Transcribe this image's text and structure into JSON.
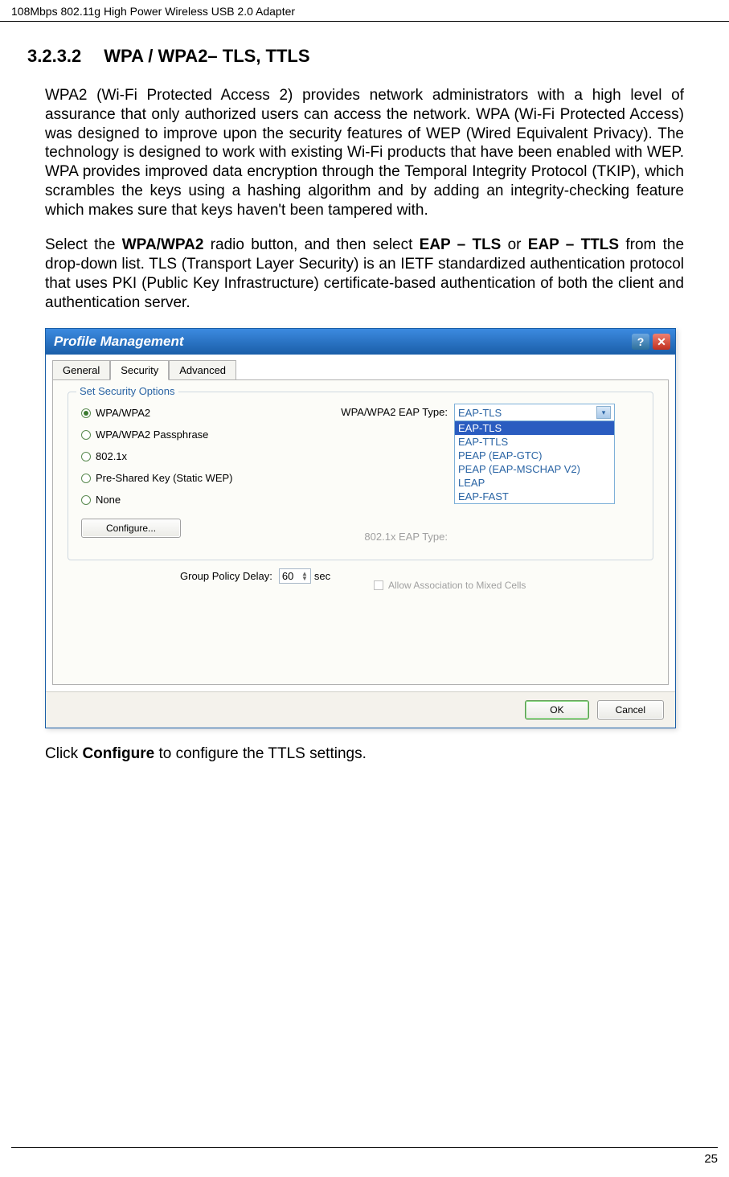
{
  "header": {
    "product": "108Mbps 802.11g High Power Wireless USB 2.0 Adapter"
  },
  "section": {
    "number": "3.2.3.2",
    "title": "WPA / WPA2– TLS, TTLS"
  },
  "paragraphs": {
    "p1": "WPA2 (Wi-Fi Protected Access 2) provides network administrators with a high level of assurance that only authorized users can access the network. WPA (Wi-Fi Protected Access) was designed to improve upon the security features of WEP (Wired Equivalent Privacy).  The technology is designed to work with existing Wi-Fi products that have been enabled with WEP.  WPA provides improved data encryption through the Temporal Integrity Protocol (TKIP), which scrambles the keys using a hashing algorithm and by adding an integrity-checking feature which makes sure that keys haven't been tampered with.",
    "p2_a": "Select the ",
    "p2_b": "WPA/WPA2",
    "p2_c": " radio button, and then select ",
    "p2_d": "EAP – TLS",
    "p2_e": " or ",
    "p2_f": "EAP – TTLS",
    "p2_g": " from the drop-down list. TLS (Transport Layer Security) is an IETF standardized authentication protocol that uses PKI (Public Key Infrastructure) certificate-based authentication of both the client and authentication server.",
    "p3_a": "Click ",
    "p3_b": "Configure",
    "p3_c": " to configure the TTLS settings."
  },
  "dialog": {
    "title": "Profile Management",
    "tabs": [
      "General",
      "Security",
      "Advanced"
    ],
    "active_tab": 1,
    "fieldset_legend": "Set Security Options",
    "radios": [
      "WPA/WPA2",
      "WPA/WPA2 Passphrase",
      "802.1x",
      "Pre-Shared Key (Static WEP)",
      "None"
    ],
    "selected_radio": 0,
    "configure_btn": "Configure...",
    "eap_label1": "WPA/WPA2 EAP Type:",
    "eap_label2": "802.1x EAP Type:",
    "eap_selected": "EAP-TLS",
    "eap_options": [
      "EAP-TLS",
      "EAP-TTLS",
      "PEAP (EAP-GTC)",
      "PEAP (EAP-MSCHAP V2)",
      "LEAP",
      "EAP-FAST"
    ],
    "mixed_cells": "Allow Association to Mixed Cells",
    "gpd_label": "Group Policy Delay:",
    "gpd_value": "60",
    "gpd_unit": "sec",
    "ok": "OK",
    "cancel": "Cancel"
  },
  "page_number": "25"
}
